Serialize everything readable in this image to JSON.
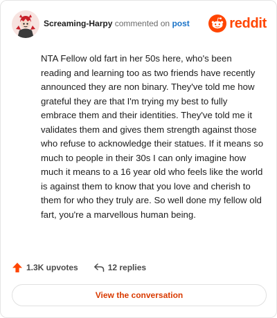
{
  "comment": {
    "username": "Screaming-Harpy",
    "action_text": "commented on",
    "post_link": "post",
    "body": "NTA Fellow old fart in her 50s here, who's been reading and learning too as two friends have recently announced they are non binary. They've told me how grateful they are that I'm trying my best to fully embrace them and their identities. They've told me it validates them and gives them strength against those who refuse to acknowledge their statues. If it means so much to people in their 30s I can only imagine how much it means to a 16 year old who feels like the world is against them to know that you love and cherish to them for who they truly are. So well done my fellow old fart, you're a marvellous human being."
  },
  "brand": {
    "wordmark": "reddit",
    "icon": "reddit-snoo-icon",
    "color": "#ff4500"
  },
  "stats": {
    "upvotes": "1.3K upvotes",
    "upvote_icon": "upvote-arrow-icon",
    "replies": "12 replies",
    "reply_icon": "reply-arrow-icon"
  },
  "cta": {
    "label": "View the conversation",
    "color": "#d93a00"
  }
}
